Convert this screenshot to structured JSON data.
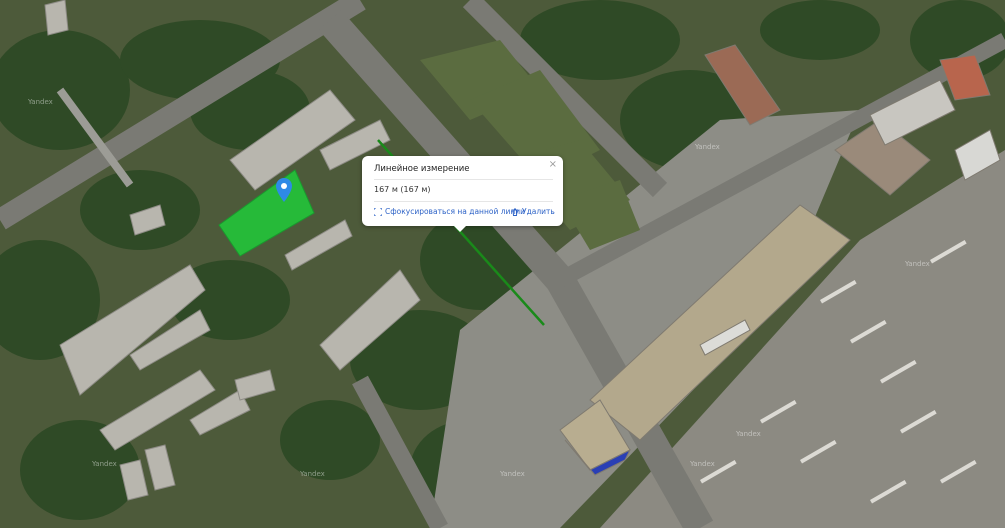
{
  "measurement_popup": {
    "title": "Линейное измерение",
    "distance": "167 м (167 м)",
    "focus_label": "Сфокусироваться на данной линии",
    "delete_label": "Удалить",
    "close_symbol": "×"
  },
  "watermarks": [
    "Yandex",
    "Yandex",
    "Yandex",
    "Yandex",
    "Yandex",
    "Yandex",
    "Yandex",
    "Yandex"
  ],
  "colors": {
    "measurement_line": "#1a8a1a",
    "area_fill": "#22c43a",
    "pin": "#2e8ae6",
    "link": "#2e63c7"
  },
  "icons": [
    "map-pin-icon",
    "focus-icon",
    "trash-icon",
    "close-icon"
  ]
}
